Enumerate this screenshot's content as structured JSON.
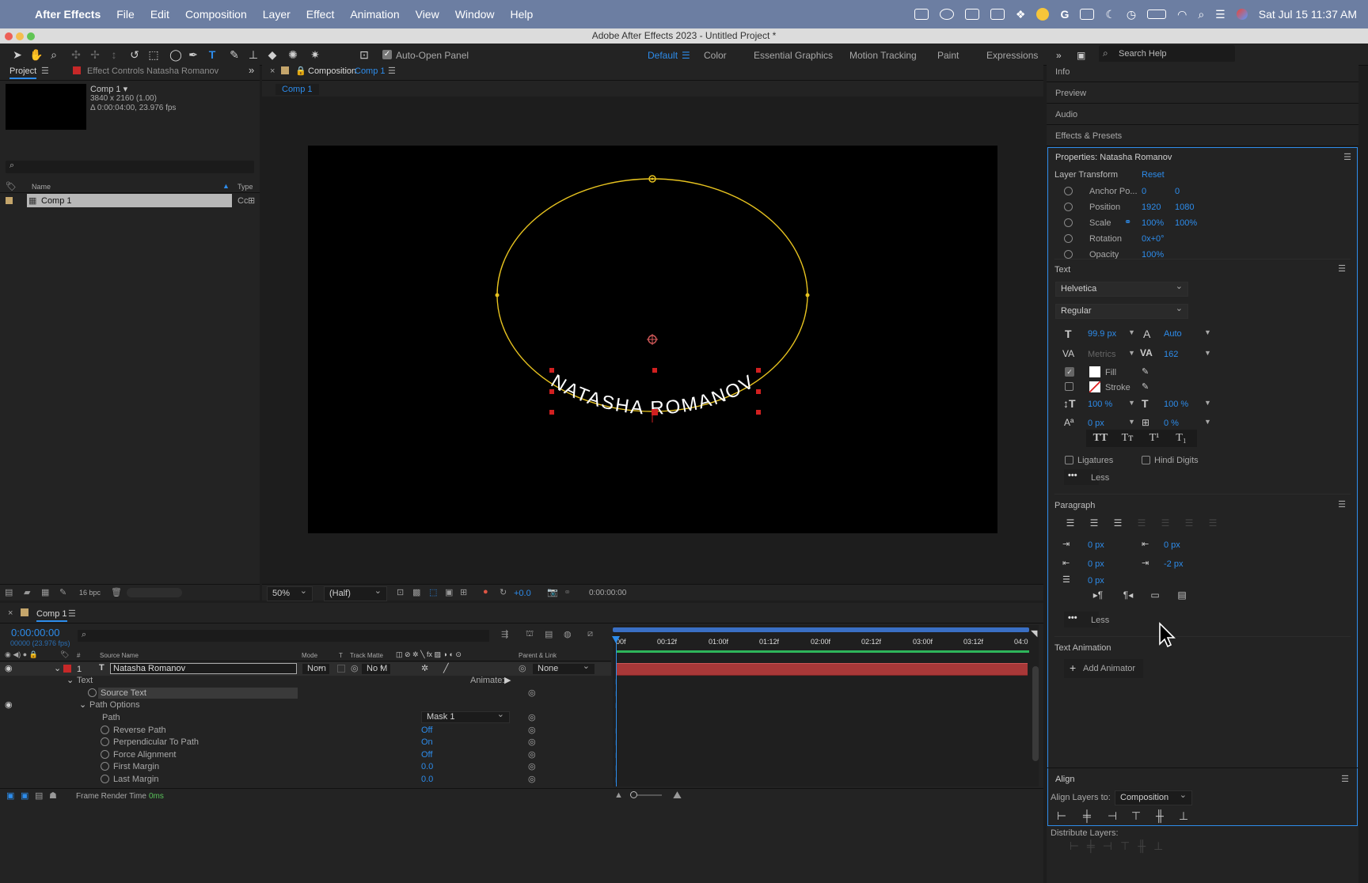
{
  "menubar": {
    "app": "After Effects",
    "items": [
      "File",
      "Edit",
      "Composition",
      "Layer",
      "Effect",
      "Animation",
      "View",
      "Window",
      "Help"
    ],
    "clock": "Sat Jul 15  11:37 AM"
  },
  "window": {
    "title": "Adobe After Effects 2023 - Untitled Project *"
  },
  "toolbar": {
    "auto_open": "Auto-Open Panel",
    "workspaces": [
      "Default",
      "Color",
      "Essential Graphics",
      "Motion Tracking",
      "Paint",
      "Expressions"
    ],
    "search": "Search Help"
  },
  "project": {
    "tab": "Project",
    "effect_tab": "Effect Controls Natasha Romanov",
    "item_name": "Comp 1 ▾",
    "item_res": "3840 x 2160 (1.00)",
    "item_dur": "Δ 0:00:04:00, 23.976 fps",
    "col_name": "Name",
    "col_type": "Type",
    "row_name": "Comp 1",
    "row_type": "Cc",
    "bpc": "16 bpc"
  },
  "comp": {
    "tab_label": "Composition",
    "tab_name": "Comp 1",
    "sub_tab": "Comp 1",
    "text": "NATASHA ROMANOV",
    "zoom": "50%",
    "quality": "(Half)",
    "exposure": "+0.0",
    "timecode": "0:00:00:00"
  },
  "right": {
    "info": "Info",
    "preview": "Preview",
    "audio": "Audio",
    "effects": "Effects & Presets"
  },
  "props": {
    "title": "Properties: Natasha Romanov",
    "layer_transform": "Layer Transform",
    "reset": "Reset",
    "rows": [
      {
        "label": "Anchor Po...",
        "v1": "0",
        "v2": "0"
      },
      {
        "label": "Position",
        "v1": "1920",
        "v2": "1080"
      },
      {
        "label": "Scale",
        "v1": "100%",
        "v2": "100%"
      },
      {
        "label": "Rotation",
        "v1": "0x+0°",
        "v2": ""
      },
      {
        "label": "Opacity",
        "v1": "100%",
        "v2": ""
      }
    ],
    "text_head": "Text",
    "font": "Helvetica",
    "style": "Regular",
    "size": "99.9 px",
    "leading": "Auto",
    "kerning": "Metrics",
    "tracking": "162",
    "fill": "Fill",
    "stroke": "Stroke",
    "vscale": "100 %",
    "hscale": "100 %",
    "baseline": "0 px",
    "tsume": "0 %",
    "ligatures": "Ligatures",
    "hindi": "Hindi Digits",
    "less": "Less",
    "paragraph": "Paragraph",
    "indent_left": "0 px",
    "space_before": "0 px",
    "indent_right": "0 px",
    "space_after": "-2 px",
    "first_indent": "0 px",
    "less2": "Less",
    "text_animation": "Text Animation",
    "add_animator": "Add Animator"
  },
  "align": {
    "title": "Align",
    "align_to_label": "Align Layers to:",
    "align_to": "Composition",
    "distribute": "Distribute Layers:"
  },
  "timeline": {
    "tab": "Comp 1",
    "timecode": "0:00:00:00",
    "fps": "00000 (23.976 fps)",
    "cols": {
      "source": "Source Name",
      "mode": "Mode",
      "t": "T",
      "track": "Track Matte",
      "parent": "Parent & Link"
    },
    "layer": {
      "num": "1",
      "name": "Natasha Romanov",
      "mode": "Norn",
      "matte": "No M",
      "parent": "None"
    },
    "animate": "Animate:",
    "frame_render": "Frame Render Time",
    "frame_ms": "0ms",
    "props": [
      {
        "label": "Text",
        "value": ""
      },
      {
        "label": "Source Text",
        "value": ""
      },
      {
        "label": "Path Options",
        "value": ""
      },
      {
        "label": "Path",
        "value": "Mask 1"
      },
      {
        "label": "Reverse Path",
        "value": "Off"
      },
      {
        "label": "Perpendicular To Path",
        "value": "On"
      },
      {
        "label": "Force Alignment",
        "value": "Off"
      },
      {
        "label": "First Margin",
        "value": "0.0"
      },
      {
        "label": "Last Margin",
        "value": "0.0"
      }
    ],
    "ruler": [
      "00f",
      "00:12f",
      "01:00f",
      "01:12f",
      "02:00f",
      "02:12f",
      "03:00f",
      "03:12f",
      "04:0"
    ]
  }
}
